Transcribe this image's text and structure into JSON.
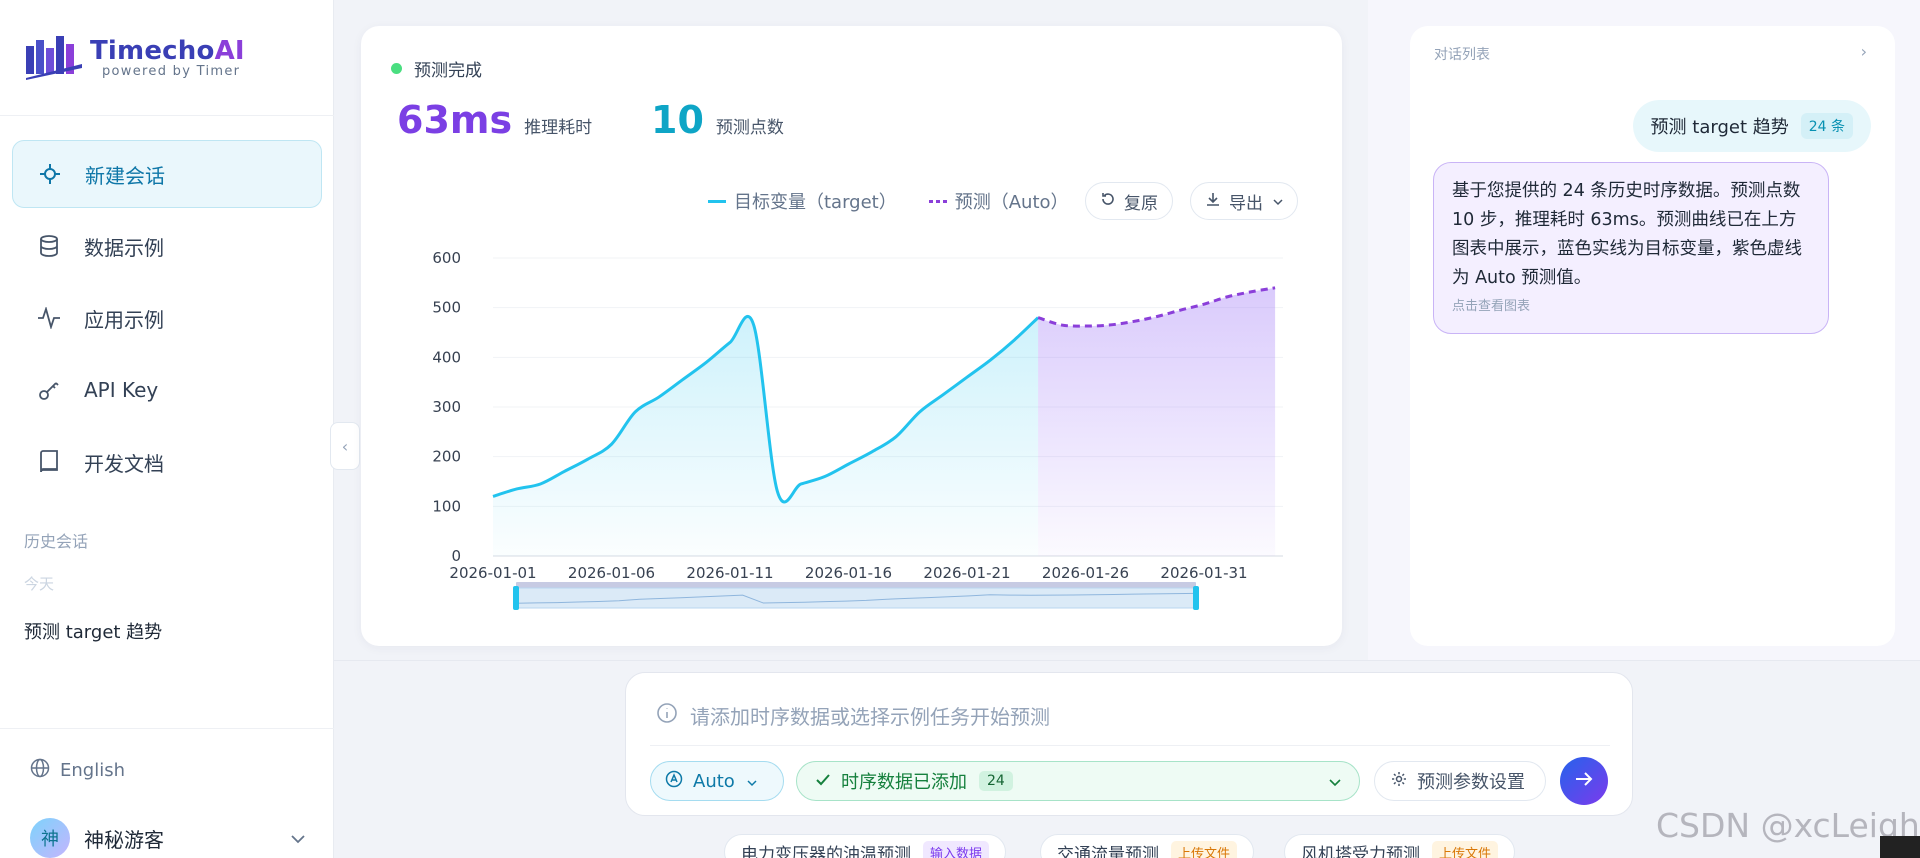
{
  "brand": {
    "title_main": "Timecho",
    "title_ai": "AI",
    "subtitle": "powered by Timer"
  },
  "nav": {
    "items": [
      {
        "label": "新建会话",
        "icon": "crosshair-icon",
        "active": true
      },
      {
        "label": "数据示例",
        "icon": "database-icon",
        "active": false
      },
      {
        "label": "应用示例",
        "icon": "activity-icon",
        "active": false
      },
      {
        "label": "API Key",
        "icon": "key-icon",
        "active": false
      },
      {
        "label": "开发文档",
        "icon": "book-icon",
        "active": false
      }
    ]
  },
  "history": {
    "heading": "历史会话",
    "group": "今天",
    "items": [
      "预测 target 趋势"
    ]
  },
  "footer": {
    "language": "English",
    "user_initial": "神",
    "user_name": "神秘游客"
  },
  "result": {
    "status": "预测完成",
    "latency_value": "63ms",
    "latency_label": "推理耗时",
    "points_value": "10",
    "points_label": "预测点数",
    "legend_actual": "目标变量（target）",
    "legend_forecast": "预测（Auto）",
    "reset_label": "复原",
    "export_label": "导出"
  },
  "chart_data": {
    "type": "line",
    "ylim": [
      0,
      600
    ],
    "yticks": [
      "0",
      "100",
      "200",
      "300",
      "400",
      "500",
      "600"
    ],
    "xticks": [
      "2026-01-01",
      "2026-01-06",
      "2026-01-11",
      "2026-01-16",
      "2026-01-21",
      "2026-01-26",
      "2026-01-31"
    ],
    "series": [
      {
        "name": "目标变量（target）",
        "color": "#22c3ee",
        "x": [
          "2026-01-01",
          "2026-01-02",
          "2026-01-03",
          "2026-01-04",
          "2026-01-05",
          "2026-01-06",
          "2026-01-07",
          "2026-01-08",
          "2026-01-09",
          "2026-01-10",
          "2026-01-11",
          "2026-01-12",
          "2026-01-13",
          "2026-01-14",
          "2026-01-15",
          "2026-01-16",
          "2026-01-17",
          "2026-01-18",
          "2026-01-19",
          "2026-01-20",
          "2026-01-21",
          "2026-01-22",
          "2026-01-23",
          "2026-01-24"
        ],
        "values": [
          120,
          135,
          145,
          170,
          195,
          225,
          290,
          320,
          355,
          390,
          430,
          465,
          130,
          145,
          160,
          185,
          210,
          240,
          290,
          325,
          360,
          395,
          435,
          480
        ]
      },
      {
        "name": "预测（Auto）",
        "color": "#8b3fd9",
        "x": [
          "2026-01-24",
          "2026-01-25",
          "2026-01-26",
          "2026-01-27",
          "2026-01-28",
          "2026-01-29",
          "2026-01-30",
          "2026-01-31",
          "2026-02-01",
          "2026-02-02",
          "2026-02-03"
        ],
        "values": [
          480,
          465,
          463,
          465,
          472,
          482,
          495,
          507,
          522,
          532,
          540
        ]
      }
    ]
  },
  "chat": {
    "title": "对话列表",
    "user_message": "预测 target 趋势",
    "user_tag": "24 条",
    "ai_message": "基于您提供的 24 条历史时序数据。预测点数 10 步，推理耗时 63ms。预测曲线已在上方图表中展示，蓝色实线为目标变量，紫色虚线为 Auto 预测值。",
    "ai_hint": "点击查看图表"
  },
  "composer": {
    "placeholder": "请添加时序数据或选择示例任务开始预测",
    "model_label": "Auto",
    "data_label": "时序数据已添加",
    "data_count": "24",
    "params_label": "预测参数设置"
  },
  "examples": [
    {
      "label": "电力变压器的油温预测",
      "tag": "输入数据",
      "tag_color": "purple"
    },
    {
      "label": "交通流量预测",
      "tag": "上传文件",
      "tag_color": "orange"
    },
    {
      "label": "风机塔受力预测",
      "tag": "上传文件",
      "tag_color": "orange"
    }
  ],
  "watermark": "CSDN @xcLeigh"
}
